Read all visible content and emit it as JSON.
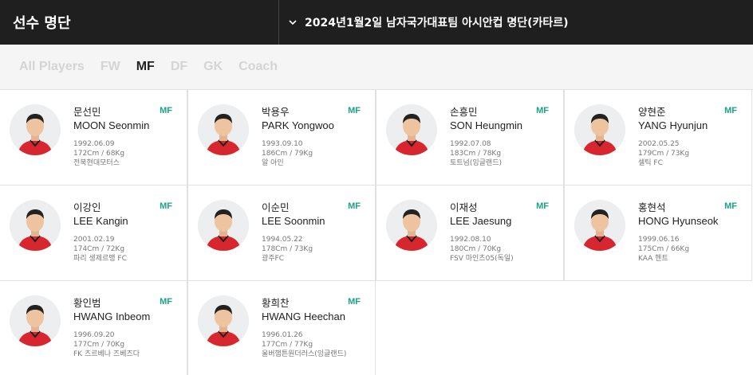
{
  "header": {
    "title": "선수 명단",
    "selected_roster": "2024년1월2일 남자국가대표팀 아시안컵 명단(카타르)"
  },
  "tabs": [
    {
      "label": "All Players",
      "active": false
    },
    {
      "label": "FW",
      "active": false
    },
    {
      "label": "MF",
      "active": true
    },
    {
      "label": "DF",
      "active": false
    },
    {
      "label": "GK",
      "active": false
    },
    {
      "label": "Coach",
      "active": false
    }
  ],
  "colors": {
    "accent": "#1aa383",
    "topbar": "#1f1f1f",
    "jersey": "#d7262e"
  },
  "players": [
    {
      "name_ko": "문선민",
      "name_en": "MOON Seonmin",
      "position": "MF",
      "birth": "1992.06.09",
      "body": "172Cm / 68Kg",
      "club": "전북현대모터스"
    },
    {
      "name_ko": "박용우",
      "name_en": "PARK Yongwoo",
      "position": "MF",
      "birth": "1993.09.10",
      "body": "186Cm / 79Kg",
      "club": "알 아인"
    },
    {
      "name_ko": "손흥민",
      "name_en": "SON Heungmin",
      "position": "MF",
      "birth": "1992.07.08",
      "body": "183Cm / 78Kg",
      "club": "토트넘(잉글랜드)"
    },
    {
      "name_ko": "양현준",
      "name_en": "YANG Hyunjun",
      "position": "MF",
      "birth": "2002.05.25",
      "body": "179Cm / 73Kg",
      "club": "셀틱 FC"
    },
    {
      "name_ko": "이강인",
      "name_en": "LEE Kangin",
      "position": "MF",
      "birth": "2001.02.19",
      "body": "174Cm / 72Kg",
      "club": "파리 생제르맹 FC"
    },
    {
      "name_ko": "이순민",
      "name_en": "LEE Soonmin",
      "position": "MF",
      "birth": "1994.05.22",
      "body": "178Cm / 73Kg",
      "club": "광주FC"
    },
    {
      "name_ko": "이재성",
      "name_en": "LEE Jaesung",
      "position": "MF",
      "birth": "1992.08.10",
      "body": "180Cm / 70Kg",
      "club": "FSV 마인츠05(독일)"
    },
    {
      "name_ko": "홍현석",
      "name_en": "HONG Hyunseok",
      "position": "MF",
      "birth": "1999.06.16",
      "body": "175Cm / 66Kg",
      "club": "KAA 헨트"
    },
    {
      "name_ko": "황인범",
      "name_en": "HWANG Inbeom",
      "position": "MF",
      "birth": "1996.09.20",
      "body": "177Cm / 70Kg",
      "club": "FK 츠르베나 즈베즈다"
    },
    {
      "name_ko": "황희찬",
      "name_en": "HWANG Heechan",
      "position": "MF",
      "birth": "1996.01.26",
      "body": "177Cm / 77Kg",
      "club": "울버햄튼원더러스(잉글랜드)"
    }
  ]
}
